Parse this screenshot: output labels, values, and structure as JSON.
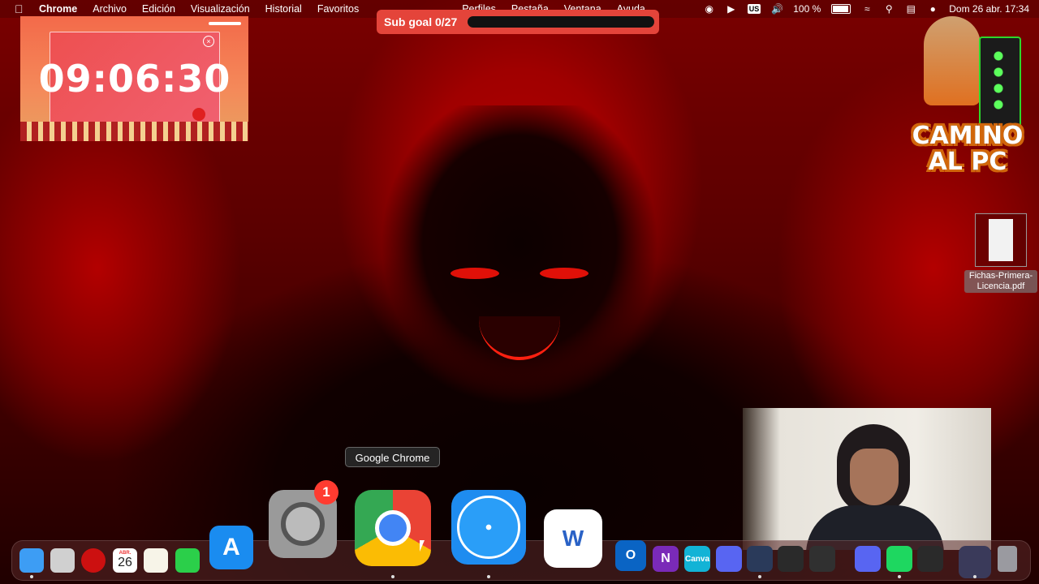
{
  "menubar": {
    "app": "Chrome",
    "menus": [
      "Archivo",
      "Edición",
      "Visualización",
      "Historial",
      "Favoritos",
      "Perfiles",
      "Pestaña",
      "Ventana",
      "Ayuda"
    ],
    "status": {
      "keyboard": "US",
      "battery": "100 %",
      "datetime": "Dom 26 abr.  17:34"
    }
  },
  "subgoal": {
    "label": "Sub goal 0/27",
    "progress": 0
  },
  "timer": {
    "time": "09:06:30"
  },
  "logo": {
    "line1": "CAMINO",
    "line2": "AL PC"
  },
  "desktop_file": {
    "name": "Fichas-Primera-Licencia.pdf"
  },
  "tooltip": {
    "text": "Google Chrome"
  },
  "dock": {
    "apps": [
      {
        "name": "Finder",
        "icon": "finder-icon",
        "color": "#3d9df4"
      },
      {
        "name": "Launchpad",
        "icon": "launchpad-icon",
        "color": "#d0d0d0"
      },
      {
        "name": "Record",
        "icon": "record-icon",
        "color": "#cc1010"
      },
      {
        "name": "Calendar",
        "icon": "calendar-icon",
        "month": "ABR.",
        "day": "26",
        "color": "#ffffff"
      },
      {
        "name": "Notes",
        "icon": "notes-icon",
        "color": "#f7f4e8"
      },
      {
        "name": "FaceTime",
        "icon": "facetime-icon",
        "color": "#2bcf4a"
      },
      {
        "name": "App Store",
        "icon": "app-store-icon",
        "color": "#1a8cf0"
      },
      {
        "name": "System Settings",
        "icon": "system-settings-icon",
        "badge": "1",
        "color": "#9a9a9a"
      },
      {
        "name": "Google Chrome",
        "icon": "chrome-icon",
        "color": "#ffffff"
      },
      {
        "name": "Safari",
        "icon": "safari-icon",
        "color": "#1e8cf0"
      },
      {
        "name": "Microsoft Word",
        "icon": "word-icon",
        "letter": "W",
        "color": "#2a62c6"
      },
      {
        "name": "Outlook",
        "icon": "outlook-icon",
        "letter": "O",
        "color": "#0a64c4"
      },
      {
        "name": "OneNote",
        "icon": "onenote-icon",
        "letter": "N",
        "color": "#7a2ab8"
      },
      {
        "name": "Canva",
        "icon": "canva-icon",
        "letter": "Canva",
        "color": "#12b3d6"
      },
      {
        "name": "Discord",
        "icon": "discord-icon",
        "color": "#5865f2"
      },
      {
        "name": "Steam",
        "icon": "steam-icon",
        "color": "#2a3a5a"
      },
      {
        "name": "OBS",
        "icon": "obs-icon",
        "color": "#2a2a2a"
      },
      {
        "name": "Streamlabs",
        "icon": "streamlabs-icon",
        "color": "#303030"
      },
      {
        "name": "Discord",
        "icon": "discord-icon",
        "color": "#5865f2"
      },
      {
        "name": "Spotify",
        "icon": "spotify-icon",
        "color": "#1ed760"
      },
      {
        "name": "OBS",
        "icon": "obs-icon",
        "color": "#2a2a2a"
      },
      {
        "name": "Window",
        "icon": "window-thumbnail-icon",
        "color": "#3a3a5a"
      },
      {
        "name": "Trash",
        "icon": "trash-icon",
        "color": "#9a9aa0"
      }
    ]
  }
}
